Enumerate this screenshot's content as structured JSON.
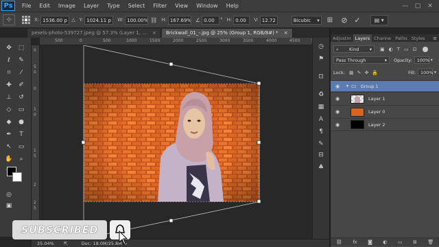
{
  "app": {
    "logo": "Ps"
  },
  "menu": [
    "File",
    "Edit",
    "Image",
    "Layer",
    "Type",
    "Select",
    "Filter",
    "View",
    "Window",
    "Help"
  ],
  "window_controls": {
    "minimize": "—",
    "maximize": "□",
    "close": "✕"
  },
  "options_bar": {
    "x_label": "X:",
    "x_value": "1536.00 p",
    "y_label": "Y:",
    "y_value": "1024.11 p",
    "w_label": "W:",
    "w_value": "100.00%",
    "h_label": "H:",
    "h_value": "167.69%",
    "angle_value": "0.00",
    "hskew_label": "H:",
    "hskew_value": "0.00",
    "vskew_label": "V:",
    "vskew_value": "12.72",
    "interpolation": "Bicubic",
    "cancel_icon": "cancel-icon",
    "commit_icon": "commit-icon",
    "workspace_icon": "workspace-icon"
  },
  "tabs": [
    {
      "label": "pexels-photo-539727.jpeg @ 57.3% (Layer 1, ...",
      "close": "×"
    },
    {
      "label": "Brickwall_01_-.jpg @ 25% (Group 1, RGB/8#) *",
      "close": "×"
    }
  ],
  "ruler_top": [
    "500",
    "0",
    "500",
    "1000",
    "1500",
    "2000",
    "2500",
    "3000",
    "3500",
    "4000",
    "4500",
    "5000"
  ],
  "ruler_left": [
    "0",
    "5",
    "0",
    "0",
    "1",
    "0",
    "1",
    "5",
    "2",
    "2",
    "5"
  ],
  "status": {
    "zoom": "25.04%",
    "doc": "Doc: 18.0M/25.8M"
  },
  "panel": {
    "tabs": [
      "Adjustm",
      "Layers",
      "Channe",
      "Paths",
      "Styles"
    ],
    "active_tab": "Layers",
    "filter_kind": "Kind",
    "blend_mode": "Pass Through",
    "opacity_label": "Opacity:",
    "opacity_value": "100%",
    "lock_label": "Lock:",
    "fill_label": "Fill:",
    "fill_value": "100%",
    "layers": [
      {
        "name": "Group 1",
        "type": "group"
      },
      {
        "name": "Layer 1",
        "type": "person"
      },
      {
        "name": "Layer 0",
        "type": "brick"
      },
      {
        "name": "Layer 2",
        "type": "black"
      }
    ],
    "footer_icons": [
      "link-icon",
      "fx-icon",
      "mask-icon",
      "adjustment-icon",
      "folder-icon",
      "new-layer-icon",
      "trash-icon"
    ]
  },
  "overlay": {
    "subscribed_label": "SUBSCRIBED"
  },
  "colors": {
    "accent": "#31a8ff",
    "brick": "#d8641f",
    "selected_layer": "#5b7bb1"
  }
}
